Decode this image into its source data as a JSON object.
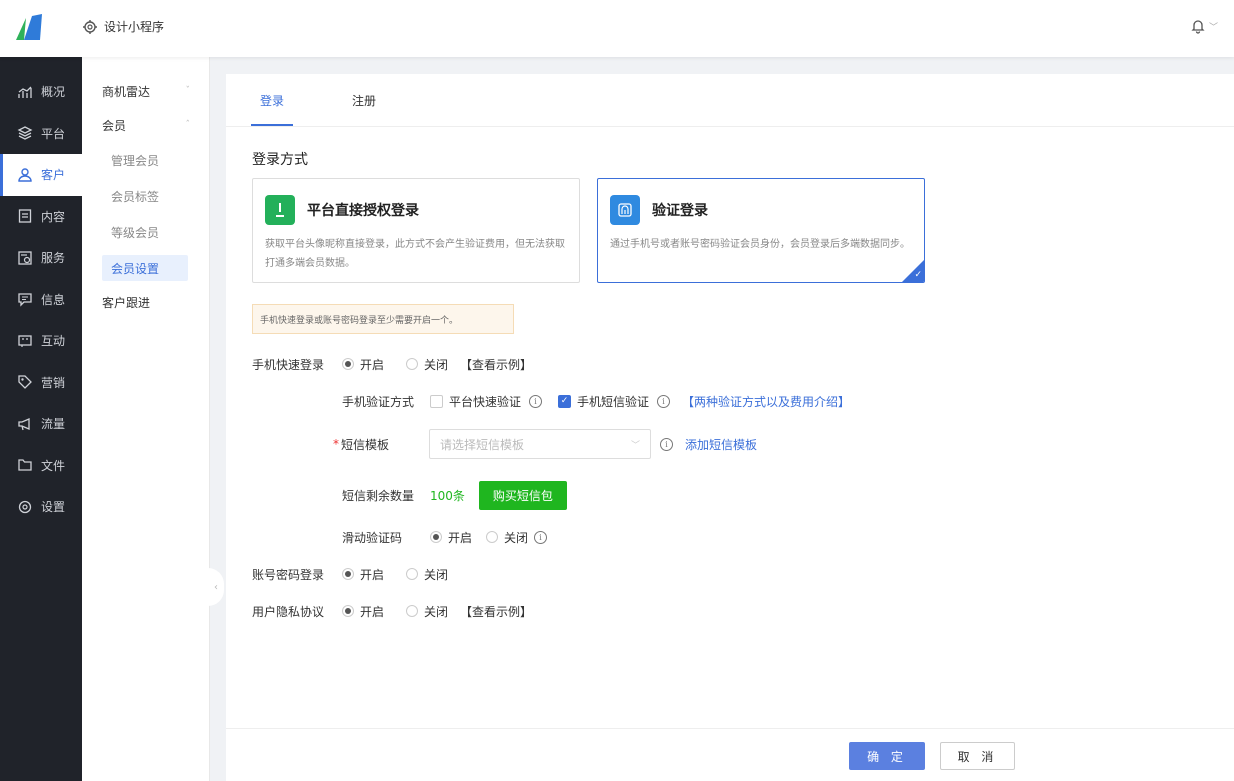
{
  "topbar": {
    "app_name": "设计小程序",
    "icons": [
      "logo",
      "settings-icon",
      "bell-icon",
      "chevron-down-icon"
    ]
  },
  "leftnav": [
    {
      "label": "概况",
      "icon": "stats-icon"
    },
    {
      "label": "平台",
      "icon": "layers-icon"
    },
    {
      "label": "客户",
      "icon": "user-icon"
    },
    {
      "label": "内容",
      "icon": "document-icon"
    },
    {
      "label": "服务",
      "icon": "service-icon"
    },
    {
      "label": "信息",
      "icon": "message-icon"
    },
    {
      "label": "互动",
      "icon": "chat-icon"
    },
    {
      "label": "营销",
      "icon": "tag-icon"
    },
    {
      "label": "流量",
      "icon": "megaphone-icon"
    },
    {
      "label": "文件",
      "icon": "folder-icon"
    },
    {
      "label": "设置",
      "icon": "gear-icon"
    }
  ],
  "subnav": {
    "radar": "商机雷达",
    "member": "会员",
    "children": [
      "管理会员",
      "会员标签",
      "等级会员",
      "会员设置"
    ],
    "followup": "客户跟进"
  },
  "tabs": [
    "登录",
    "注册"
  ],
  "section_title": "登录方式",
  "cards": [
    {
      "title": "平台直接授权登录",
      "desc": "获取平台头像昵称直接登录，此方式不会产生验证费用，但无法获取打通多端会员数据。"
    },
    {
      "title": "验证登录",
      "desc": "通过手机号或者账号密码验证会员身份，会员登录后多端数据同步。"
    }
  ],
  "notice": "手机快速登录或账号密码登录至少需要开启一个。",
  "form": {
    "quick_login": {
      "label": "手机快速登录",
      "on": "开启",
      "off": "关闭",
      "example": "【查看示例】"
    },
    "verify": {
      "label": "手机验证方式",
      "opt1": "平台快速验证",
      "opt2": "手机短信验证",
      "link": "【两种验证方式以及费用介绍】"
    },
    "sms_template": {
      "required": "*",
      "label": "短信模板",
      "placeholder": "请选择短信模板",
      "add": "添加短信模板"
    },
    "sms_remain": {
      "label": "短信剩余数量",
      "count": "100条",
      "buy": "购买短信包"
    },
    "slider": {
      "label": "滑动验证码",
      "on": "开启",
      "off": "关闭"
    },
    "account_login": {
      "label": "账号密码登录",
      "on": "开启",
      "off": "关闭"
    },
    "privacy": {
      "label": "用户隐私协议",
      "on": "开启",
      "off": "关闭",
      "example": "【查看示例】"
    }
  },
  "footer": {
    "ok": "确 定",
    "cancel": "取 消"
  },
  "colors": {
    "accent": "#3b6fd9",
    "green": "#1fb61f",
    "dark_nav": "#20232a"
  }
}
